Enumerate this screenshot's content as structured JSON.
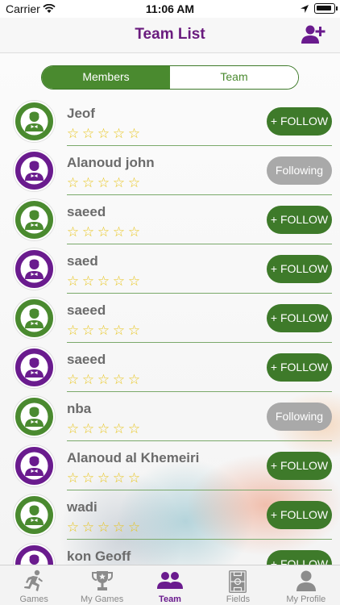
{
  "status_bar": {
    "carrier": "Carrier",
    "time": "11:06 AM"
  },
  "header": {
    "title": "Team List"
  },
  "segments": [
    {
      "label": "Members",
      "active": true
    },
    {
      "label": "Team",
      "active": false
    }
  ],
  "members": [
    {
      "name": "Jeof",
      "avatar_color": "green",
      "rating": 0,
      "button": "+ FOLLOW",
      "following": false
    },
    {
      "name": "Alanoud john",
      "avatar_color": "purple",
      "rating": 0,
      "button": "Following",
      "following": true
    },
    {
      "name": "saeed",
      "avatar_color": "green",
      "rating": 0,
      "button": "+ FOLLOW",
      "following": false
    },
    {
      "name": "saed",
      "avatar_color": "purple",
      "rating": 0,
      "button": "+ FOLLOW",
      "following": false
    },
    {
      "name": "saeed",
      "avatar_color": "green",
      "rating": 0,
      "button": "+ FOLLOW",
      "following": false
    },
    {
      "name": "saeed",
      "avatar_color": "purple",
      "rating": 0,
      "button": "+ FOLLOW",
      "following": false
    },
    {
      "name": "nba",
      "avatar_color": "green",
      "rating": 0,
      "button": "Following",
      "following": true
    },
    {
      "name": "Alanoud al Khemeiri",
      "avatar_color": "purple",
      "rating": 0,
      "button": "+ FOLLOW",
      "following": false
    },
    {
      "name": "wadi",
      "avatar_color": "green",
      "rating": 0,
      "button": "+ FOLLOW",
      "following": false
    },
    {
      "name": "kon Geoff",
      "avatar_color": "purple",
      "rating": 0,
      "button": "+ FOLLOW",
      "following": false
    }
  ],
  "star_glyph": "☆",
  "tabs": [
    {
      "label": "Games",
      "icon": "runner-icon",
      "active": false
    },
    {
      "label": "My Games",
      "icon": "trophy-icon",
      "active": false
    },
    {
      "label": "Team",
      "icon": "team-icon",
      "active": true
    },
    {
      "label": "Fields",
      "icon": "field-icon",
      "active": false
    },
    {
      "label": "My Profile",
      "icon": "profile-icon",
      "active": false
    }
  ],
  "colors": {
    "brand_purple": "#6a1b8e",
    "brand_green": "#3e7a2a",
    "star": "#e8c51d",
    "following_gray": "#a9a9a9"
  }
}
